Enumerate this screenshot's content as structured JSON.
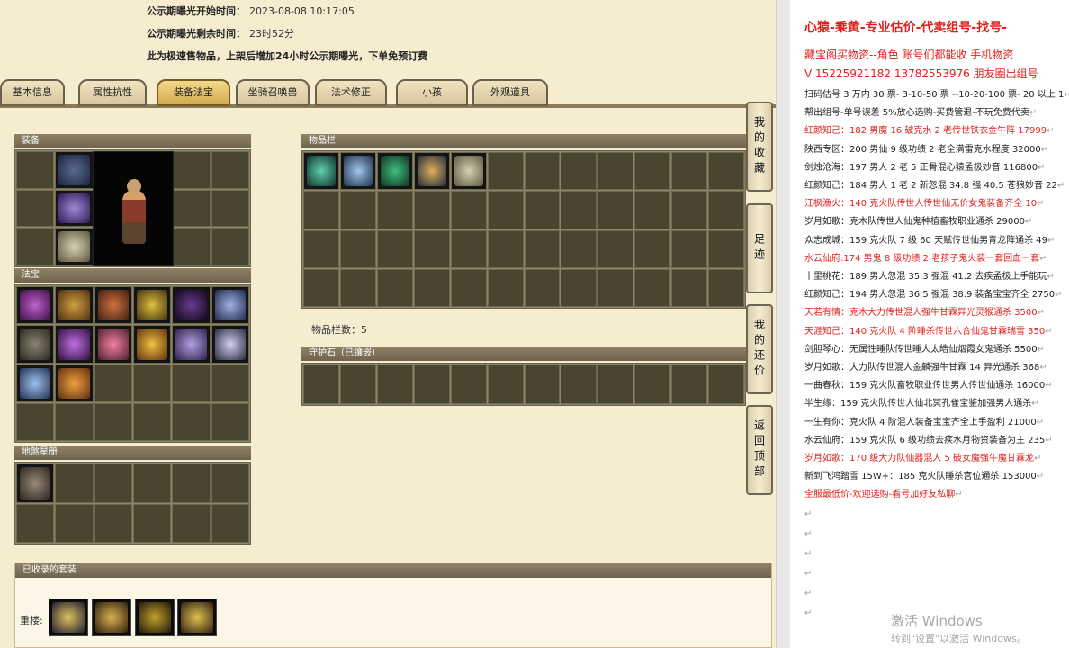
{
  "info": {
    "start_label": "公示期曝光开始时间：",
    "start_value": "2023-08-08 10:17:05",
    "remain_label": "公示期曝光剩余时间：",
    "remain_value": "23时52分",
    "notice": "此为极速售物品，上架后增加24小时公示期曝光，下单免预订费"
  },
  "tabs": [
    "基本信息",
    "属性抗性",
    "装备法宝",
    "坐骑召唤兽",
    "法术修正",
    "小孩",
    "外观道具"
  ],
  "active_tab": "装备法宝",
  "panels": {
    "equip": "装备",
    "fabao": "法宝",
    "disha": "地煞星册",
    "inventory": "物品栏",
    "inventory_count": "物品栏数：5",
    "guard": "守护石（已镶嵌）",
    "suits": "已收录的套装",
    "suit_row_label": "重楼:"
  },
  "side_nav": [
    "我的收藏",
    "足迹",
    "我的还价",
    "返回顶部"
  ],
  "doc": {
    "title": "心猿-乘黄-专业估价-代卖组号-找号-",
    "line1": "藏宝阁买物资--角色 账号们都能收  手机物资",
    "line2": "V 15225921182  13782553976 朋友圈出组号",
    "lines": [
      {
        "text": "扫码估号 3 万内 30 票- 3-10-50 票  --10-20-100 票- 20 以上 1",
        "red": false
      },
      {
        "text": "帮出组号-单号误差 5%放心选购-买费管退-不玩免费代卖",
        "red": false
      },
      {
        "text": "红颜知己：182 男魔 16 破克水 2 老传世铁衣金牛阵 17999",
        "red": true
      },
      {
        "text": "陕西专区：200 男仙 9 级功绩 2 老全满雷克水程度 32000",
        "red": false
      },
      {
        "text": "剑烛沧海：197 男人 2 老 5 正骨混心猿孟极妙音 116800",
        "red": false
      },
      {
        "text": "红颜知己：184 男人 1 老 2 新忽混 34.8 强 40.5 苍狼妙音 22",
        "red": false
      },
      {
        "text": "江枫渔火：140 克火队传世人传世仙无价女鬼装备齐全 10",
        "red": true
      },
      {
        "text": "岁月如歌：克木队传世人仙鬼种植畜牧职业通杀 29000",
        "red": false
      },
      {
        "text": "众志成城：159 克火队 7 级 60 天赋传世仙男青龙阵通杀 49",
        "red": false
      },
      {
        "text": "水云仙府:174 男鬼 8 级功绩 2 老孩子鬼火装一套回血一套",
        "red": true
      },
      {
        "text": "十里桃花：189 男人忽混 35.3 强混 41.2 去疾孟极上手能玩",
        "red": false
      },
      {
        "text": "红颜知己：194 男人忽混 36.5 强混 38.9 装备宝宝齐全 2750",
        "red": false
      },
      {
        "text": "天若有情：克木大力传世混人强牛甘霖异光灵猴通杀 3500",
        "red": true
      },
      {
        "text": "天涯知己：140 克火队 4 阶睡杀传世六合仙鬼甘霖瑞雪 350",
        "red": true
      },
      {
        "text": "剑胆琴心：无属性睡队传世睡人太皓仙烟霞女鬼通杀 5500",
        "red": false
      },
      {
        "text": "岁月如歌：大力队传世混人金麟强牛甘霖 14 异光通杀 368",
        "red": false
      },
      {
        "text": "一曲春秋：159 克火队畜牧职业传世男人传世仙通杀 16000",
        "red": false
      },
      {
        "text": "半生缘：159 克火队传世人仙北冥孔雀宝鉴加强男人通杀",
        "red": false
      },
      {
        "text": "一生有你：克火队 4 阶混人装备宝宝齐全上手盈利 21000",
        "red": false
      },
      {
        "text": "水云仙府：159 克火队 6 级功绩去疾水月物资装备为主 235",
        "red": false
      },
      {
        "text": "岁月如歌：170 级大力队仙器混人 5 破女魔强牛魔甘霖龙",
        "red": true
      },
      {
        "text": "新到飞鸿踏雪 15W+：185 克火队睡杀宫位通杀 153000",
        "red": false
      },
      {
        "text": "全服最低价-欢迎选购-看号加好友私聊",
        "red": true
      }
    ],
    "watermark1": "激活 Windows",
    "watermark2": "转到\"设置\"以激活 Windows。"
  },
  "colors": {
    "panel_bg": "#f6ecd0",
    "grid_cell": "#4a4530",
    "accent_red": "#e0201c",
    "tab_active": "#d4aa50"
  }
}
